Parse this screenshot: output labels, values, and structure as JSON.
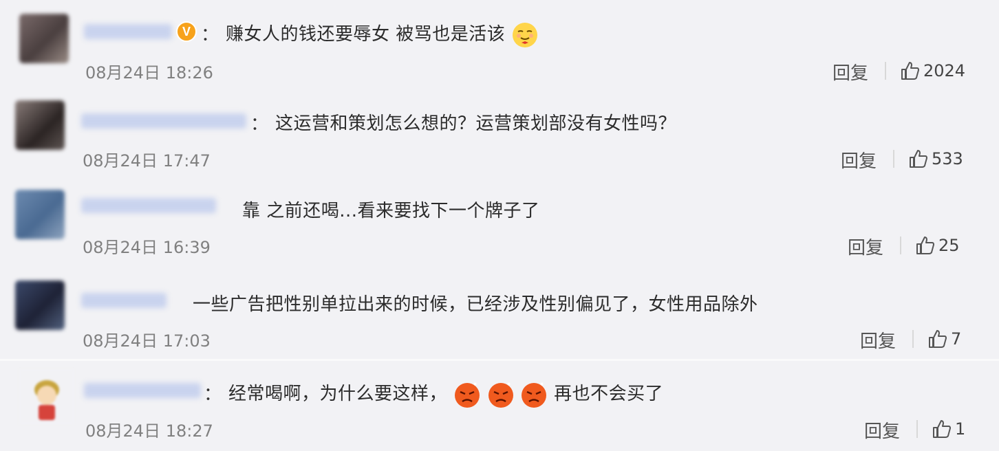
{
  "comments": [
    {
      "text": "赚女人的钱还要辱女 被骂也是活该",
      "time": "08月24日 18:26",
      "reply": "回复",
      "likes": "2024",
      "emoji": "smirk-face-emoji"
    },
    {
      "text": "这运营和策划怎么想的？运营策划部没有女性吗？",
      "time": "08月24日 17:47",
      "reply": "回复",
      "likes": "533"
    },
    {
      "text": "靠 之前还喝...看来要找下一个牌子了",
      "time": "08月24日 16:39",
      "reply": "回复",
      "likes": "25"
    },
    {
      "text": "一些广告把性别单拉出来的时候，已经涉及性别偏见了，女性用品除外",
      "time": "08月24日 17:03",
      "reply": "回复",
      "likes": "7"
    },
    {
      "text": "经常喝啊，为什么要这样，",
      "text_after": "再也不会买了",
      "time": "08月24日 18:27",
      "reply": "回复",
      "likes": "1",
      "emoji": "angry-face-emoji"
    }
  ],
  "colon": "：",
  "verified_badge": "V",
  "colors": {
    "background": "#f2f2f5",
    "time": "#808080",
    "badge": "#f7a21b"
  }
}
